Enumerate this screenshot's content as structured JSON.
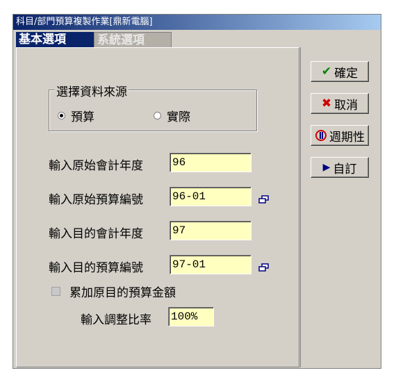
{
  "window": {
    "title": "科目/部門預算複製作業[鼎新電腦]"
  },
  "tabs": [
    {
      "label": "基本選項",
      "active": true
    },
    {
      "label": "系統選項",
      "active": false
    }
  ],
  "source_group": {
    "legend": "選擇資料來源",
    "options": [
      {
        "label": "預算",
        "checked": true
      },
      {
        "label": "實際",
        "checked": false
      }
    ]
  },
  "form": {
    "orig_year_label": "輸入原始會計年度",
    "orig_year_value": "96",
    "orig_budget_label": "輸入原始預算編號",
    "orig_budget_value": "96-01",
    "target_year_label": "輸入目的會計年度",
    "target_year_value": "97",
    "target_budget_label": "輸入目的預算編號",
    "target_budget_value": "97-01",
    "accumulate_label": "累加原目的預算金額",
    "accumulate_checked": false,
    "ratio_label": "輸入調整比率",
    "ratio_value": "100%"
  },
  "buttons": {
    "ok": "確定",
    "cancel": "取消",
    "periodic": "週期性",
    "custom": "自訂"
  },
  "colors": {
    "title_bar": "#0a246a",
    "field_bg": "#ffffc0",
    "ok_icon": "#008000",
    "cancel_icon": "#cc0000",
    "custom_icon": "#000080"
  }
}
